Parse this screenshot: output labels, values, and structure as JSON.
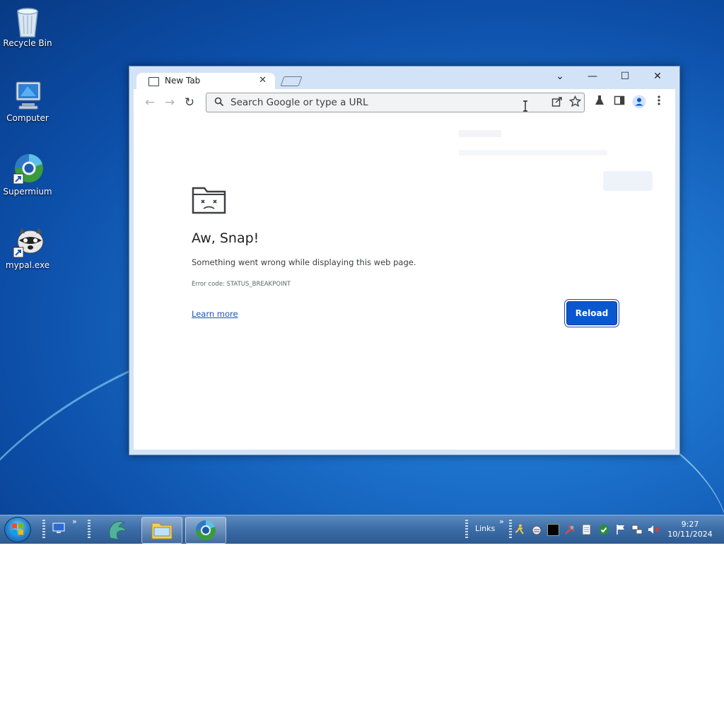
{
  "desktop": {
    "icons": [
      {
        "label": "Recycle Bin",
        "icon": "recycle-bin-icon"
      },
      {
        "label": "Computer",
        "icon": "computer-icon"
      },
      {
        "label": "Supermium",
        "icon": "supermium-icon"
      },
      {
        "label": "mypal.exe",
        "icon": "mypal-icon"
      }
    ]
  },
  "browser": {
    "tab_title": "New Tab",
    "tab_close": "✕",
    "window_controls": {
      "tabsearch": "⌄",
      "minimize": "—",
      "maximize": "☐",
      "close": "✕"
    },
    "nav": {
      "back": "←",
      "forward": "→",
      "reload": "↻"
    },
    "omnibox_placeholder": "Search Google or type a URL",
    "error": {
      "title": "Aw, Snap!",
      "message": "Something went wrong while displaying this web page.",
      "code": "Error code: STATUS_BREAKPOINT",
      "learn_more": "Learn more",
      "reload_button": "Reload"
    }
  },
  "taskbar": {
    "links_label": "Links",
    "chevron": "»",
    "clock_time": "9:27",
    "clock_date": "10/11/2024"
  },
  "colors": {
    "accent": "#0b57d0",
    "taskbar": "#3d6ea8",
    "desktop": "#1b6fc9"
  }
}
